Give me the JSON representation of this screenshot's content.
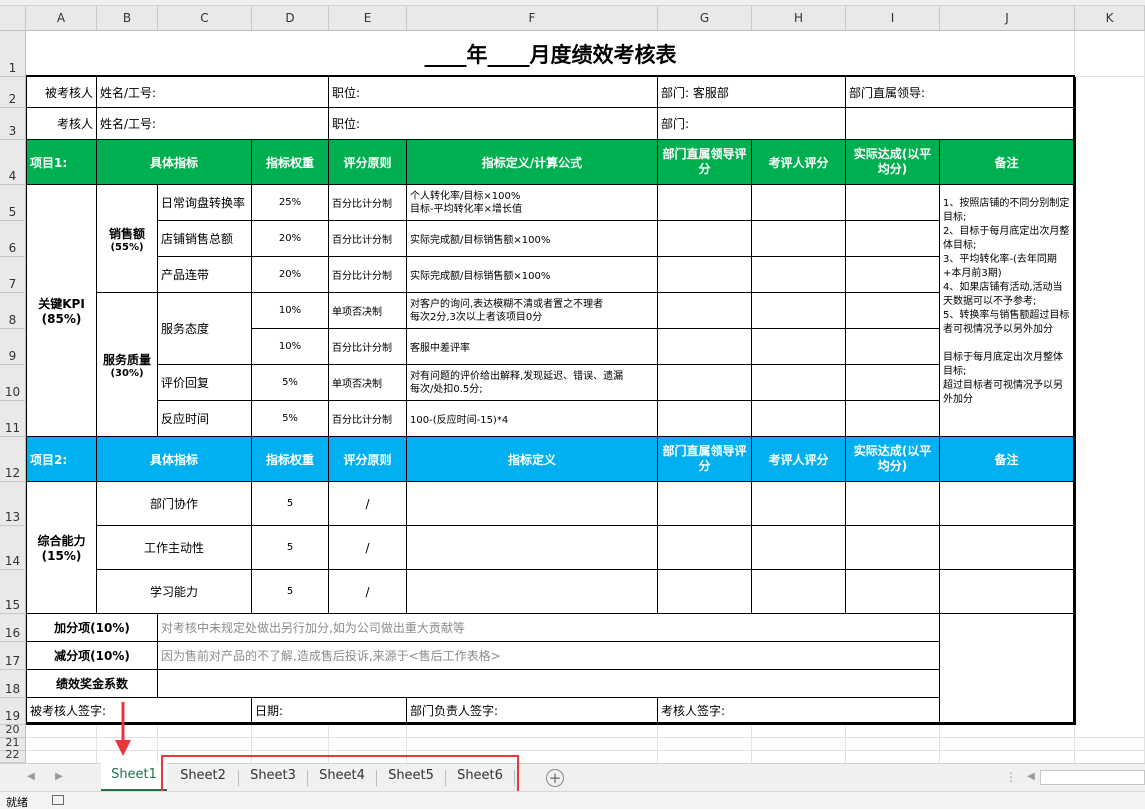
{
  "columns": [
    "A",
    "B",
    "C",
    "D",
    "E",
    "F",
    "G",
    "H",
    "I",
    "J",
    "K"
  ],
  "rows": [
    "1",
    "2",
    "3",
    "4",
    "5",
    "6",
    "7",
    "8",
    "9",
    "10",
    "11",
    "12",
    "13",
    "14",
    "15",
    "16",
    "17",
    "18",
    "19",
    "20",
    "21",
    "22"
  ],
  "title": "____年____月度绩效考核表",
  "info": {
    "examinee": "被考核人",
    "examinee_name": "姓名/工号:",
    "examinee_position": "职位:",
    "examinee_dept": "部门:  客服部",
    "examinee_leader": "部门直属领导:",
    "examiner": "考核人",
    "examiner_name": "姓名/工号:",
    "examiner_position": "职位:",
    "examiner_dept": "部门:"
  },
  "header1": {
    "project": "项目1:",
    "indicator": "具体指标",
    "weight": "指标权重",
    "principle": "评分原则",
    "definition": "指标定义/计算公式",
    "leader_score": "部门直属领导评分",
    "assessor_score": "考评人评分",
    "actual": "实际达成(以平均分)",
    "remark": "备注"
  },
  "kpi": {
    "label": "关键KPI",
    "pct": "(85%)"
  },
  "sales": {
    "label": "销售额",
    "pct": "(55%)"
  },
  "service": {
    "label": "服务质量",
    "pct": "(30%)"
  },
  "items": [
    {
      "name": "日常询盘转换率",
      "weight": "25%",
      "principle": "百分比计分制",
      "def": "个人转化率/目标×100%\n目标-平均转化率×增长值"
    },
    {
      "name": "店铺销售总额",
      "weight": "20%",
      "principle": "百分比计分制",
      "def": "实际完成额/目标销售额×100%"
    },
    {
      "name": "产品连带",
      "weight": "20%",
      "principle": "百分比计分制",
      "def": "实际完成额/目标销售额×100%"
    },
    {
      "name": "服务态度",
      "weight": "10%",
      "principle": "单项否决制",
      "def": "对客户的询问,表达模糊不清或者置之不理者\n每次2分,3次以上者该项目0分"
    },
    {
      "name": "",
      "weight": "10%",
      "principle": "百分比计分制",
      "def": "客服中差评率"
    },
    {
      "name": "评价回复",
      "weight": "5%",
      "principle": "单项否决制",
      "def": "对有问题的评价给出解释,发现延迟、错误、遗漏\n每次/处扣0.5分;"
    },
    {
      "name": "反应时间",
      "weight": "5%",
      "principle": "百分比计分制",
      "def": "100-(反应时间-15)*4"
    }
  ],
  "remark1": "1、按照店铺的不同分别制定目标;\n2、目标于每月底定出次月整体目标;\n3、平均转化率-(去年同期+本月前3期)\n4、如果店铺有活动,活动当天数据可以不予参考;\n5、转换率与销售额超过目标者可视情况予以另外加分\n\n目标于每月底定出次月整体目标;\n超过目标者可视情况予以另外加分",
  "header2": {
    "project": "项目2:",
    "indicator": "具体指标",
    "weight": "指标权重",
    "principle": "评分原则",
    "definition": "指标定义",
    "leader_score": "部门直属领导评分",
    "assessor_score": "考评人评分",
    "actual": "实际达成(以平均分)",
    "remark": "备注"
  },
  "ability": {
    "label": "综合能力",
    "pct": "(15%)"
  },
  "items2": [
    {
      "name": "部门协作",
      "weight": "5",
      "principle": "/"
    },
    {
      "name": "工作主动性",
      "weight": "5",
      "principle": "/"
    },
    {
      "name": "学习能力",
      "weight": "5",
      "principle": "/"
    }
  ],
  "bonus": {
    "label": "加分项(10%)",
    "text": "对考核中未规定处做出另行加分,如为公司做出重大贡献等"
  },
  "minus": {
    "label": "减分项(10%)",
    "text": "因为售前对产品的不了解,造成售后投诉,来源于<售后工作表格>"
  },
  "coef": {
    "label": "绩效奖金系数"
  },
  "sign": {
    "examinee": "被考核人签字:",
    "date": "日期:",
    "leader": "部门负责人签字:",
    "examiner": "考核人签字:"
  },
  "sheets": [
    "Sheet1",
    "Sheet2",
    "Sheet3",
    "Sheet4",
    "Sheet5",
    "Sheet6"
  ],
  "status": "就绪",
  "colors": {
    "green": "#00b050",
    "blue": "#00b0f0",
    "annotation": "#e8373b",
    "active_tab": "#217346"
  }
}
